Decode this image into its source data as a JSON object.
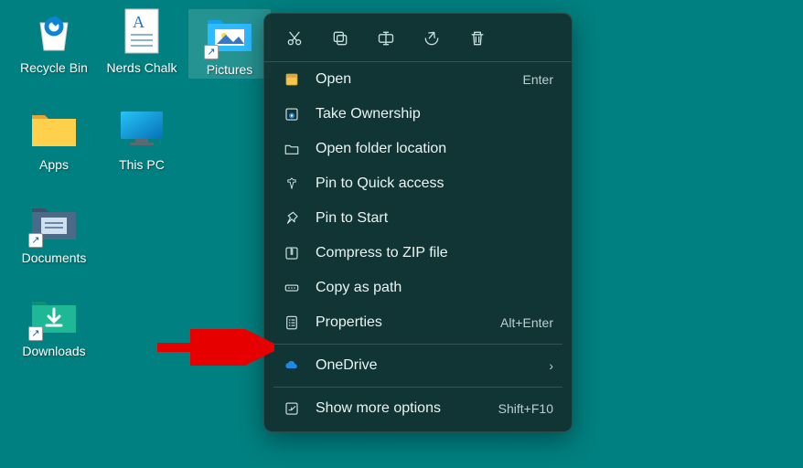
{
  "desktop": {
    "icons": [
      {
        "id": "recycle-bin",
        "label": "Recycle Bin",
        "type": "recycle",
        "selected": false,
        "shortcut": false
      },
      {
        "id": "nerds-chalk",
        "label": "Nerds Chalk",
        "type": "doc",
        "selected": false,
        "shortcut": false
      },
      {
        "id": "pictures",
        "label": "Pictures",
        "type": "pictures-folder",
        "selected": true,
        "shortcut": true
      },
      {
        "id": "apps",
        "label": "Apps",
        "type": "folder",
        "selected": false,
        "shortcut": false
      },
      {
        "id": "this-pc",
        "label": "This PC",
        "type": "pc",
        "selected": false,
        "shortcut": false
      },
      {
        "id": "spacer1",
        "label": "",
        "type": "empty"
      },
      {
        "id": "documents",
        "label": "Documents",
        "type": "documents-folder",
        "selected": false,
        "shortcut": true
      },
      {
        "id": "spacer2",
        "label": "",
        "type": "empty"
      },
      {
        "id": "spacer3",
        "label": "",
        "type": "empty"
      },
      {
        "id": "downloads",
        "label": "Downloads",
        "type": "downloads-folder",
        "selected": false,
        "shortcut": true
      }
    ]
  },
  "context_menu": {
    "toolbar": [
      {
        "id": "cut",
        "name": "cut-icon"
      },
      {
        "id": "copy",
        "name": "copy-icon"
      },
      {
        "id": "rename",
        "name": "rename-icon"
      },
      {
        "id": "share",
        "name": "share-icon"
      },
      {
        "id": "delete",
        "name": "delete-icon"
      }
    ],
    "items": [
      {
        "icon": "open-icon",
        "label": "Open",
        "shortcut": "Enter"
      },
      {
        "icon": "owner-icon",
        "label": "Take Ownership",
        "shortcut": ""
      },
      {
        "icon": "folder-icon",
        "label": "Open folder location",
        "shortcut": ""
      },
      {
        "icon": "pin-icon",
        "label": "Pin to Quick access",
        "shortcut": ""
      },
      {
        "icon": "pin2-icon",
        "label": "Pin to Start",
        "shortcut": ""
      },
      {
        "icon": "zip-icon",
        "label": "Compress to ZIP file",
        "shortcut": ""
      },
      {
        "icon": "path-icon",
        "label": "Copy as path",
        "shortcut": ""
      },
      {
        "icon": "props-icon",
        "label": "Properties",
        "shortcut": "Alt+Enter"
      },
      {
        "separator": true
      },
      {
        "icon": "onedrive-icon",
        "label": "OneDrive",
        "shortcut": "",
        "submenu": true
      },
      {
        "separator": true
      },
      {
        "icon": "more-icon",
        "label": "Show more options",
        "shortcut": "Shift+F10"
      }
    ]
  },
  "annotation": {
    "arrow_color": "#e60000"
  }
}
